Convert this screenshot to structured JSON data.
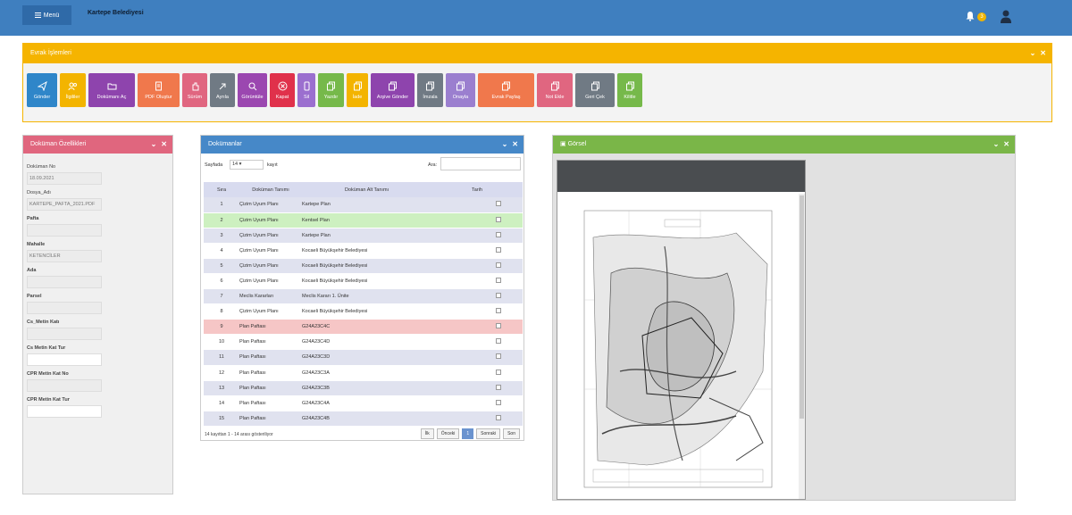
{
  "header": {
    "menu_label": "Menü",
    "org_name": "Kartepe Belediyesi",
    "notification_count": "3"
  },
  "operations": {
    "title": "Evrak İşlemleri",
    "buttons": [
      {
        "label": "Gönder",
        "color": "#2f86c9",
        "icon": "send-icon"
      },
      {
        "label": "İlgililer",
        "color": "#f3b400",
        "icon": "people-icon"
      },
      {
        "label": "Dokümanı Aç",
        "color": "#8e44ad",
        "icon": "folder-icon"
      },
      {
        "label": "PDF Oluştur",
        "color": "#f0784c",
        "icon": "document-icon"
      },
      {
        "label": "Sürüm",
        "color": "#e06680",
        "icon": "hand-icon"
      },
      {
        "label": "Ayrıla",
        "color": "#707a84",
        "icon": "arrow-icon"
      },
      {
        "label": "Görüntüle",
        "color": "#9b47b0",
        "icon": "search-icon"
      },
      {
        "label": "Kapat",
        "color": "#e0314b",
        "icon": "close-icon"
      },
      {
        "label": "Sil",
        "color": "#9b6fcf",
        "icon": "phone-icon"
      },
      {
        "label": "Yazdır",
        "color": "#76b94a",
        "icon": "copy-icon"
      },
      {
        "label": "İade",
        "color": "#f3b400",
        "icon": "copy-icon"
      },
      {
        "label": "Arşive Gönder",
        "color": "#8e44ad",
        "icon": "copy-icon"
      },
      {
        "label": "İmzala",
        "color": "#707a84",
        "icon": "copy-icon"
      },
      {
        "label": "Onayla",
        "color": "#9b7fcf",
        "icon": "copy-icon"
      },
      {
        "label": "Evrak Paylaş",
        "color": "#f0784c",
        "icon": "copy-icon"
      },
      {
        "label": "Not Ekle",
        "color": "#e06680",
        "icon": "copy-icon"
      },
      {
        "label": "Geri Çek",
        "color": "#707a84",
        "icon": "copy-icon"
      },
      {
        "label": "Kilitle",
        "color": "#76b94a",
        "icon": "copy-icon"
      }
    ]
  },
  "properties": {
    "title": "Doküman Özellikleri",
    "fields": [
      {
        "label": "Doküman No",
        "value": "18.09.2021",
        "bold": false,
        "white": false
      },
      {
        "label": "Dosya_Adı",
        "value": "KARTEPE_PAFTA_2021.PDF",
        "bold": false,
        "white": false
      },
      {
        "label": "Pafta",
        "value": "",
        "bold": true,
        "white": false
      },
      {
        "label": "Mahalle",
        "value": "KETENCİLER",
        "bold": true,
        "white": false
      },
      {
        "label": "Ada",
        "value": "",
        "bold": true,
        "white": false
      },
      {
        "label": "Parsel",
        "value": "",
        "bold": true,
        "white": false
      },
      {
        "label": "Cs_Metin Katı",
        "value": "",
        "bold": true,
        "white": false
      },
      {
        "label": "Cs Metin Kat Tur",
        "value": "",
        "bold": true,
        "white": true
      },
      {
        "label": "CPR Metin Kat No",
        "value": "",
        "bold": true,
        "white": false
      },
      {
        "label": "CPR Metin Kat Tur",
        "value": "",
        "bold": true,
        "white": true
      }
    ]
  },
  "documents": {
    "title": "Dokümanlar",
    "page_size_label": "Sayfada",
    "page_size": "14",
    "page_size_unit": "kayıt",
    "search_label": "Ara:",
    "columns": [
      "Sıra",
      "Doküman Tanımı",
      "Doküman Alt Tanımı",
      "Tarih"
    ],
    "rows": [
      {
        "no": "1",
        "type": "Çizim Uyum Planı",
        "sub": "Kartepe Plan",
        "style": "even"
      },
      {
        "no": "2",
        "type": "Çizim Uyum Planı",
        "sub": "Kentsel Plan",
        "style": "green"
      },
      {
        "no": "3",
        "type": "Çizim Uyum Planı",
        "sub": "Kartepe Plan",
        "style": "even"
      },
      {
        "no": "4",
        "type": "Çizim Uyum Planı",
        "sub": "Kocaeli Büyükşehir Belediyesi",
        "style": "odd"
      },
      {
        "no": "5",
        "type": "Çizim Uyum Planı",
        "sub": "Kocaeli Büyükşehir Belediyesi",
        "style": "even"
      },
      {
        "no": "6",
        "type": "Çizim Uyum Planı",
        "sub": "Kocaeli Büyükşehir Belediyesi",
        "style": "odd"
      },
      {
        "no": "7",
        "type": "Meclis Kararları",
        "sub": "Meclis Kararı 1. Ünite",
        "style": "even"
      },
      {
        "no": "8",
        "type": "Çizim Uyum Planı",
        "sub": "Kocaeli Büyükşehir Belediyesi",
        "style": "odd"
      },
      {
        "no": "9",
        "type": "Plan Paftası",
        "sub": "G24A23C4C",
        "style": "red"
      },
      {
        "no": "10",
        "type": "Plan Paftası",
        "sub": "G24A23C4D",
        "style": "odd"
      },
      {
        "no": "11",
        "type": "Plan Paftası",
        "sub": "G24A23C3D",
        "style": "even"
      },
      {
        "no": "12",
        "type": "Plan Paftası",
        "sub": "G24A23C3A",
        "style": "odd"
      },
      {
        "no": "13",
        "type": "Plan Paftası",
        "sub": "G24A23C3B",
        "style": "even"
      },
      {
        "no": "14",
        "type": "Plan Paftası",
        "sub": "G24A23C4A",
        "style": "odd"
      },
      {
        "no": "15",
        "type": "Plan Paftası",
        "sub": "G24A23C4B",
        "style": "even"
      }
    ],
    "footer_info": "14 kayıttan 1 - 14 arası gösteriliyor",
    "pager": {
      "first": "İlk",
      "prev": "Önceki",
      "current": "1",
      "next": "Sonraki",
      "last": "Son"
    }
  },
  "image_panel": {
    "title": "Görsel"
  }
}
